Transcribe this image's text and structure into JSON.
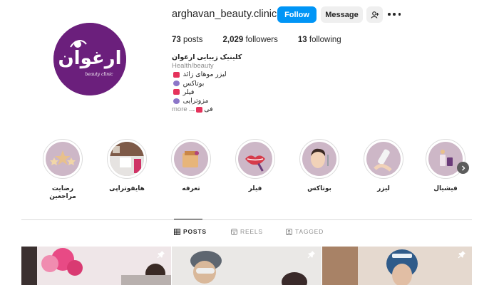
{
  "profile": {
    "username": "arghavan_beauty.clinic",
    "follow_label": "Follow",
    "message_label": "Message",
    "avatar_logo_text": "ارغوان",
    "avatar_logo_sub": "beauty clinic"
  },
  "stats": {
    "posts_count": "73",
    "posts_label": "posts",
    "followers_count": "2,029",
    "followers_label": "followers",
    "following_count": "13",
    "following_label": "following"
  },
  "bio": {
    "name": "کلینیک زیبایی ارغوان",
    "category": "Health/beauty",
    "lines": [
      {
        "text": "لیزر موهای زائد",
        "emoji": "heart"
      },
      {
        "text": "بوتاکس",
        "emoji": "purple"
      },
      {
        "text": "فیلر",
        "emoji": "heart"
      },
      {
        "text": "مزوتراپی",
        "emoji": "purple"
      },
      {
        "text": "فی",
        "emoji": "heart"
      }
    ],
    "ellipsis": "...",
    "more_label": "more"
  },
  "highlights": [
    {
      "label": "رضایت مراجعین",
      "icon": "stars-icon"
    },
    {
      "label": "هایفوتراپی",
      "icon": "clinic-room-icon"
    },
    {
      "label": "تعرفه",
      "icon": "price-tag-icon"
    },
    {
      "label": "فیلر",
      "icon": "lips-filler-icon"
    },
    {
      "label": "بوتاکس",
      "icon": "face-injection-icon"
    },
    {
      "label": "لیزر",
      "icon": "laser-device-icon"
    },
    {
      "label": "فیشیال",
      "icon": "facial-products-icon"
    }
  ],
  "tabs": [
    {
      "label": "POSTS",
      "icon": "grid-icon",
      "active": true
    },
    {
      "label": "REELS",
      "icon": "reels-icon",
      "active": false
    },
    {
      "label": "TAGGED",
      "icon": "tagged-icon",
      "active": false
    }
  ],
  "posts": [
    {
      "pinned": true,
      "desc": "balloons"
    },
    {
      "pinned": true,
      "desc": "woman in cap"
    },
    {
      "pinned": true,
      "desc": "clinic staff"
    }
  ],
  "colors": {
    "brand_purple": "#6b1f7c",
    "follow_blue": "#0095f6",
    "highlight_bg": "#cdb7c7"
  }
}
